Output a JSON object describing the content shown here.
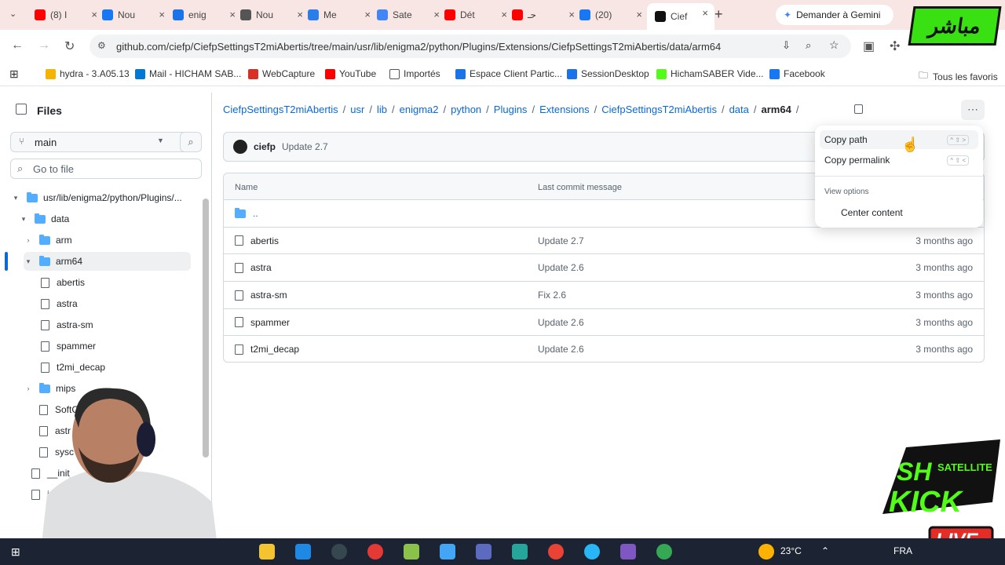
{
  "browser": {
    "tabs": [
      {
        "label": "(8) I",
        "color": "#ff0000"
      },
      {
        "label": "Nou",
        "color": "#1877f2"
      },
      {
        "label": "enig",
        "color": "#1a73e8"
      },
      {
        "label": "Nou",
        "color": "#555555"
      },
      {
        "label": "Me",
        "color": "#2b7de9"
      },
      {
        "label": "Sate",
        "color": "#4285f4"
      },
      {
        "label": "Dét",
        "color": "#ff0000"
      },
      {
        "label": "حـ",
        "color": "#ff0000"
      },
      {
        "label": "(20)",
        "color": "#1877f2"
      },
      {
        "label": "Cief",
        "color": "#111111"
      }
    ],
    "new_tab": "+",
    "gemini_label": "Demander à Gemini",
    "url": "github.com/ciefp/CiefpSettingsT2miAbertis/tree/main/usr/lib/enigma2/python/Plugins/Extensions/CiefpSettingsT2miAbertis/data/arm64",
    "bookmarks": [
      {
        "label": "hydra - 3.A05.13",
        "color": "#f5b400"
      },
      {
        "label": "Mail - HICHAM SAB...",
        "color": "#0078d4"
      },
      {
        "label": "WebCapture",
        "color": "#d93025"
      },
      {
        "label": "YouTube",
        "color": "#ff0000"
      },
      {
        "label": "Importés",
        "color": "#ffffff"
      },
      {
        "label": "Espace Client Partic...",
        "color": "#1a73e8"
      },
      {
        "label": "SessionDesktop",
        "color": "#1a73e8"
      },
      {
        "label": "HichamSABER Vide...",
        "color": "#53fc18"
      },
      {
        "label": "Facebook",
        "color": "#1877f2"
      }
    ],
    "all_bookmarks": "Tous les favoris"
  },
  "sidebar": {
    "title": "Files",
    "branch": "main",
    "go_to_file": "Go to file",
    "tree": [
      {
        "label": "usr/lib/enigma2/python/Plugins/...",
        "type": "folder",
        "chevron": "▾"
      },
      {
        "label": "data",
        "type": "folder",
        "chevron": "▾"
      },
      {
        "label": "arm",
        "type": "folder",
        "chevron": "›"
      },
      {
        "label": "arm64",
        "type": "folder",
        "chevron": "▾"
      },
      {
        "label": "abertis",
        "type": "file"
      },
      {
        "label": "astra",
        "type": "file"
      },
      {
        "label": "astra-sm",
        "type": "file"
      },
      {
        "label": "spammer",
        "type": "file"
      },
      {
        "label": "t2mi_decap",
        "type": "file"
      },
      {
        "label": "mips",
        "type": "folder",
        "chevron": "›"
      },
      {
        "label": "SoftCa",
        "type": "file"
      },
      {
        "label": "astr",
        "type": "file"
      },
      {
        "label": "sysc",
        "type": "file"
      },
      {
        "label": "__init_",
        "type": "file"
      },
      {
        "label": "ico",
        "type": "file"
      }
    ]
  },
  "breadcrumb": {
    "parts": [
      "CiefpSettingsT2miAbertis",
      "usr",
      "lib",
      "enigma2",
      "python",
      "Plugins",
      "Extensions",
      "CiefpSettingsT2miAbertis",
      "data"
    ],
    "current": "arm64",
    "trailing_sep": "/"
  },
  "commit": {
    "author": "ciefp",
    "message": "Update 2.7"
  },
  "table": {
    "headers": {
      "name": "Name",
      "message": "Last commit message"
    },
    "parent": "..",
    "rows": [
      {
        "name": "abertis",
        "message": "Update 2.7",
        "date": "3 months ago"
      },
      {
        "name": "astra",
        "message": "Update 2.6",
        "date": "3 months ago"
      },
      {
        "name": "astra-sm",
        "message": "Fix 2.6",
        "date": "3 months ago"
      },
      {
        "name": "spammer",
        "message": "Update 2.6",
        "date": "3 months ago"
      },
      {
        "name": "t2mi_decap",
        "message": "Update 2.6",
        "date": "3 months ago"
      }
    ]
  },
  "menu": {
    "copy_path": "Copy path",
    "copy_path_kbd": "^ ⇧ >",
    "copy_permalink": "Copy permalink",
    "copy_permalink_kbd": "^ ⇧ <",
    "section": "View options",
    "center_content": "Center content"
  },
  "taskbar": {
    "temperature": "23°C",
    "lang": "FRA"
  },
  "overlay": {
    "logo_text": "مباشر"
  }
}
